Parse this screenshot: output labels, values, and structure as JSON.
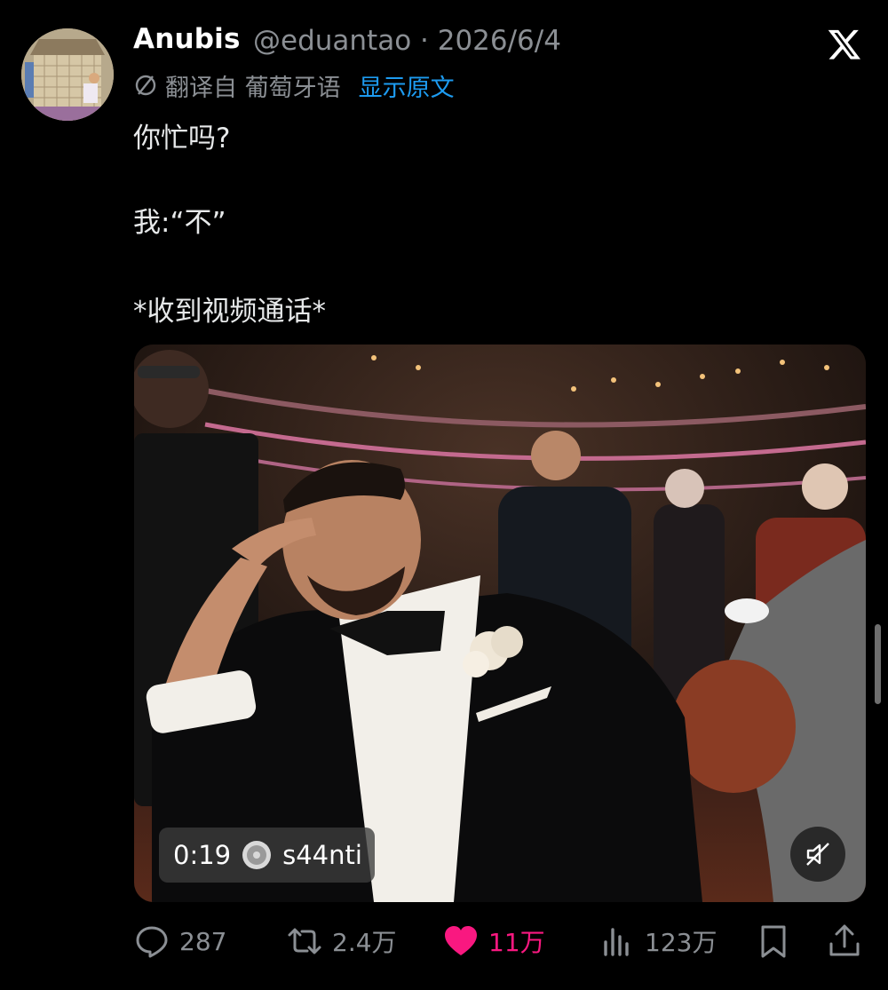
{
  "post": {
    "author_name": "Anubis",
    "handle_and_date": "@eduantao · 2026/6/4",
    "translated_from": "翻译自 葡萄牙语",
    "show_original": "显示原文",
    "text_lines": [
      "你忙吗?",
      "我:“不”",
      "*收到视频通话*"
    ]
  },
  "media": {
    "duration": "0:19",
    "audio_handle": "s44nti",
    "mute_icon": "speaker-muted-icon"
  },
  "actions": {
    "replies": "287",
    "reposts": "2.4万",
    "likes": "11万",
    "views": "123万"
  },
  "colors": {
    "background": "#000000",
    "text": "#e7e9ea",
    "secondary": "#8b8f94",
    "link": "#1d9bf0",
    "like": "#f91880"
  }
}
